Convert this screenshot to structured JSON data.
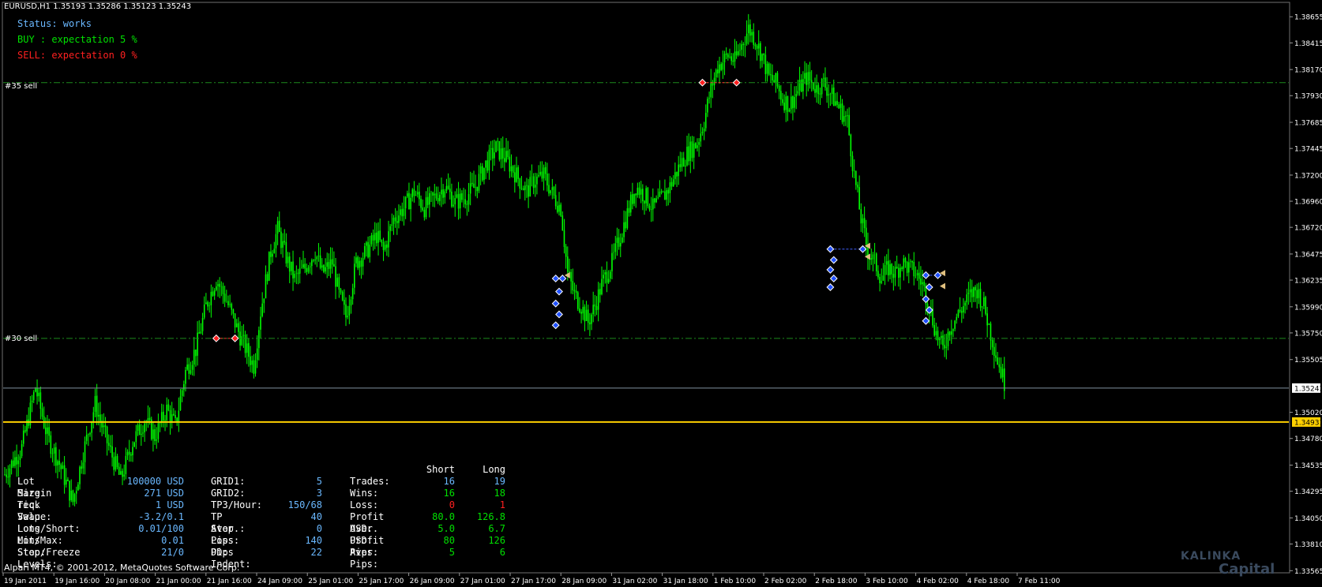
{
  "header": {
    "symbol_line": "EURUSD,H1  1.35193 1.35286 1.35123 1.35243"
  },
  "status_panel": {
    "status": "Status: works",
    "buy": "BUY : expectation 5 %",
    "sell": "SELL: expectation 0 %"
  },
  "level_labels": {
    "sell35": "#35 sell",
    "sell30": "#30 sell"
  },
  "stats": {
    "col1": [
      {
        "label": "Lot Size:",
        "value": "100000 USD"
      },
      {
        "label": "Margin req.",
        "value": "271 USD"
      },
      {
        "label": "Tick Value:",
        "value": "1 USD"
      },
      {
        "label": "Swap Long/Short:",
        "value": "-3.2/0.1"
      },
      {
        "label": "Lots Min/Max:",
        "value": "0.01/100"
      },
      {
        "label": "Lots Step:",
        "value": "0.01"
      },
      {
        "label": "Stop/Freeze Levels:",
        "value": "21/0"
      }
    ],
    "col2": [
      {
        "label": "GRID1:",
        "value": "5"
      },
      {
        "label": "GRID2:",
        "value": "3"
      },
      {
        "label": "TP3/Hour:",
        "value": "150/68"
      },
      {
        "label": "TP Aver.:",
        "value": "40"
      },
      {
        "label": "Stop Loss:",
        "value": "0"
      },
      {
        "label": "Pips DD:",
        "value": "140"
      },
      {
        "label": "Pips Indent:",
        "value": "22"
      }
    ],
    "col3_header_short": "Short",
    "col3_header_long": "Long",
    "col3": [
      {
        "label": "Trades:",
        "short": "16",
        "long": "19"
      },
      {
        "label": "Wins:",
        "short": "16",
        "long": "18"
      },
      {
        "label": "Loss:",
        "short": "0",
        "long": "1"
      },
      {
        "label": "Profit USD:",
        "short": "80.0",
        "long": "126.8"
      },
      {
        "label": "Aver. USD:",
        "short": "5.0",
        "long": "6.7"
      },
      {
        "label": "Profit Pips:",
        "short": "80",
        "long": "126"
      },
      {
        "label": "Aver. Pips:",
        "short": "5",
        "long": "6"
      }
    ]
  },
  "footer": {
    "copyright": "Alpari MT4, © 2001-2012, MetaQuotes Software Corp.",
    "logo_top": "KALINKA",
    "logo_bottom": "Capital"
  },
  "colors": {
    "background": "#000000",
    "candle": "#00ff00",
    "grid_line": "#1d8a1d",
    "bid_line": "#7f8fa0",
    "level_line": "#ffd000",
    "status_text": "#6ab8ff",
    "buy_text": "#00e000",
    "sell_text": "#ff2020",
    "stats_label": "#ffffff",
    "stats_value": "#6ab8ff"
  },
  "chart_data": {
    "type": "candlestick",
    "symbol": "EURUSD",
    "timeframe": "H1",
    "ohlc_current": {
      "open": 1.35193,
      "high": 1.35286,
      "low": 1.35123,
      "close": 1.35243
    },
    "ylim": [
      1.3356,
      1.3878
    ],
    "y_ticks": [
      "1.38655",
      "1.38415",
      "1.38170",
      "1.37930",
      "1.37685",
      "1.37445",
      "1.37200",
      "1.36960",
      "1.36720",
      "1.36475",
      "1.36235",
      "1.35990",
      "1.35750",
      "1.35505",
      "1.35243",
      "1.35020",
      "1.34931",
      "1.34780",
      "1.34535",
      "1.34295",
      "1.34050",
      "1.33810",
      "1.33565"
    ],
    "x_ticks": [
      "19 Jan 2011",
      "19 Jan 16:00",
      "20 Jan 08:00",
      "21 Jan 00:00",
      "21 Jan 16:00",
      "24 Jan 09:00",
      "25 Jan 01:00",
      "25 Jan 17:00",
      "26 Jan 09:00",
      "27 Jan 01:00",
      "27 Jan 17:00",
      "28 Jan 09:00",
      "31 Jan 02:00",
      "31 Jan 18:00",
      "1 Feb 10:00",
      "2 Feb 02:00",
      "2 Feb 18:00",
      "3 Feb 10:00",
      "4 Feb 02:00",
      "4 Feb 18:00",
      "7 Feb 11:00"
    ],
    "close_path": [
      [
        0,
        1.3445
      ],
      [
        10,
        1.347
      ],
      [
        18,
        1.3525
      ],
      [
        25,
        1.348
      ],
      [
        32,
        1.3455
      ],
      [
        40,
        1.342
      ],
      [
        46,
        1.3465
      ],
      [
        53,
        1.351
      ],
      [
        60,
        1.3475
      ],
      [
        68,
        1.344
      ],
      [
        75,
        1.3475
      ],
      [
        82,
        1.3495
      ],
      [
        88,
        1.348
      ],
      [
        95,
        1.3505
      ],
      [
        100,
        1.349
      ],
      [
        106,
        1.354
      ],
      [
        112,
        1.356
      ],
      [
        118,
        1.36
      ],
      [
        124,
        1.3625
      ],
      [
        130,
        1.3605
      ],
      [
        136,
        1.358
      ],
      [
        140,
        1.3565
      ],
      [
        146,
        1.3545
      ],
      [
        150,
        1.3595
      ],
      [
        156,
        1.365
      ],
      [
        160,
        1.367
      ],
      [
        166,
        1.364
      ],
      [
        170,
        1.3625
      ],
      [
        176,
        1.3635
      ],
      [
        182,
        1.365
      ],
      [
        186,
        1.363
      ],
      [
        192,
        1.364
      ],
      [
        196,
        1.361
      ],
      [
        200,
        1.359
      ],
      [
        206,
        1.364
      ],
      [
        212,
        1.365
      ],
      [
        218,
        1.3665
      ],
      [
        222,
        1.365
      ],
      [
        228,
        1.368
      ],
      [
        234,
        1.369
      ],
      [
        240,
        1.3705
      ],
      [
        246,
        1.369
      ],
      [
        252,
        1.37
      ],
      [
        258,
        1.371
      ],
      [
        264,
        1.3695
      ],
      [
        270,
        1.37
      ],
      [
        276,
        1.371
      ],
      [
        282,
        1.373
      ],
      [
        288,
        1.3745
      ],
      [
        294,
        1.3735
      ],
      [
        300,
        1.372
      ],
      [
        306,
        1.3705
      ],
      [
        310,
        1.3715
      ],
      [
        316,
        1.372
      ],
      [
        322,
        1.37
      ],
      [
        326,
        1.369
      ],
      [
        330,
        1.363
      ],
      [
        334,
        1.361
      ],
      [
        338,
        1.36
      ],
      [
        342,
        1.3585
      ],
      [
        346,
        1.36
      ],
      [
        350,
        1.362
      ],
      [
        356,
        1.364
      ],
      [
        360,
        1.366
      ],
      [
        366,
        1.369
      ],
      [
        370,
        1.371
      ],
      [
        376,
        1.37
      ],
      [
        380,
        1.369
      ],
      [
        386,
        1.37
      ],
      [
        390,
        1.371
      ],
      [
        396,
        1.373
      ],
      [
        400,
        1.374
      ],
      [
        406,
        1.375
      ],
      [
        410,
        1.377
      ],
      [
        414,
        1.38
      ],
      [
        418,
        1.382
      ],
      [
        424,
        1.383
      ],
      [
        428,
        1.3825
      ],
      [
        432,
        1.384
      ],
      [
        436,
        1.3855
      ],
      [
        440,
        1.3845
      ],
      [
        444,
        1.383
      ],
      [
        448,
        1.381
      ],
      [
        452,
        1.3805
      ],
      [
        456,
        1.379
      ],
      [
        460,
        1.3785
      ],
      [
        466,
        1.38
      ],
      [
        470,
        1.381
      ],
      [
        476,
        1.38
      ],
      [
        480,
        1.3805
      ],
      [
        486,
        1.379
      ],
      [
        490,
        1.378
      ],
      [
        494,
        1.377
      ],
      [
        498,
        1.372
      ],
      [
        502,
        1.368
      ],
      [
        506,
        1.365
      ],
      [
        510,
        1.364
      ],
      [
        514,
        1.3625
      ],
      [
        518,
        1.3635
      ],
      [
        522,
        1.363
      ],
      [
        526,
        1.364
      ],
      [
        530,
        1.3635
      ],
      [
        534,
        1.363
      ],
      [
        538,
        1.362
      ],
      [
        542,
        1.36
      ],
      [
        546,
        1.3575
      ],
      [
        550,
        1.356
      ],
      [
        554,
        1.358
      ],
      [
        558,
        1.359
      ],
      [
        562,
        1.36
      ],
      [
        566,
        1.361
      ],
      [
        570,
        1.3615
      ],
      [
        574,
        1.36
      ],
      [
        578,
        1.3575
      ],
      [
        582,
        1.355
      ],
      [
        586,
        1.353
      ]
    ],
    "horizontal_levels": [
      {
        "label": "#35 sell",
        "price": 1.3805,
        "style": "dash-dot"
      },
      {
        "label": "#30 sell",
        "price": 1.357,
        "style": "dash-dot"
      },
      {
        "label": "bid",
        "price": 1.35243,
        "style": "solid"
      },
      {
        "label": "level",
        "price": 1.34931,
        "style": "solid"
      }
    ]
  }
}
